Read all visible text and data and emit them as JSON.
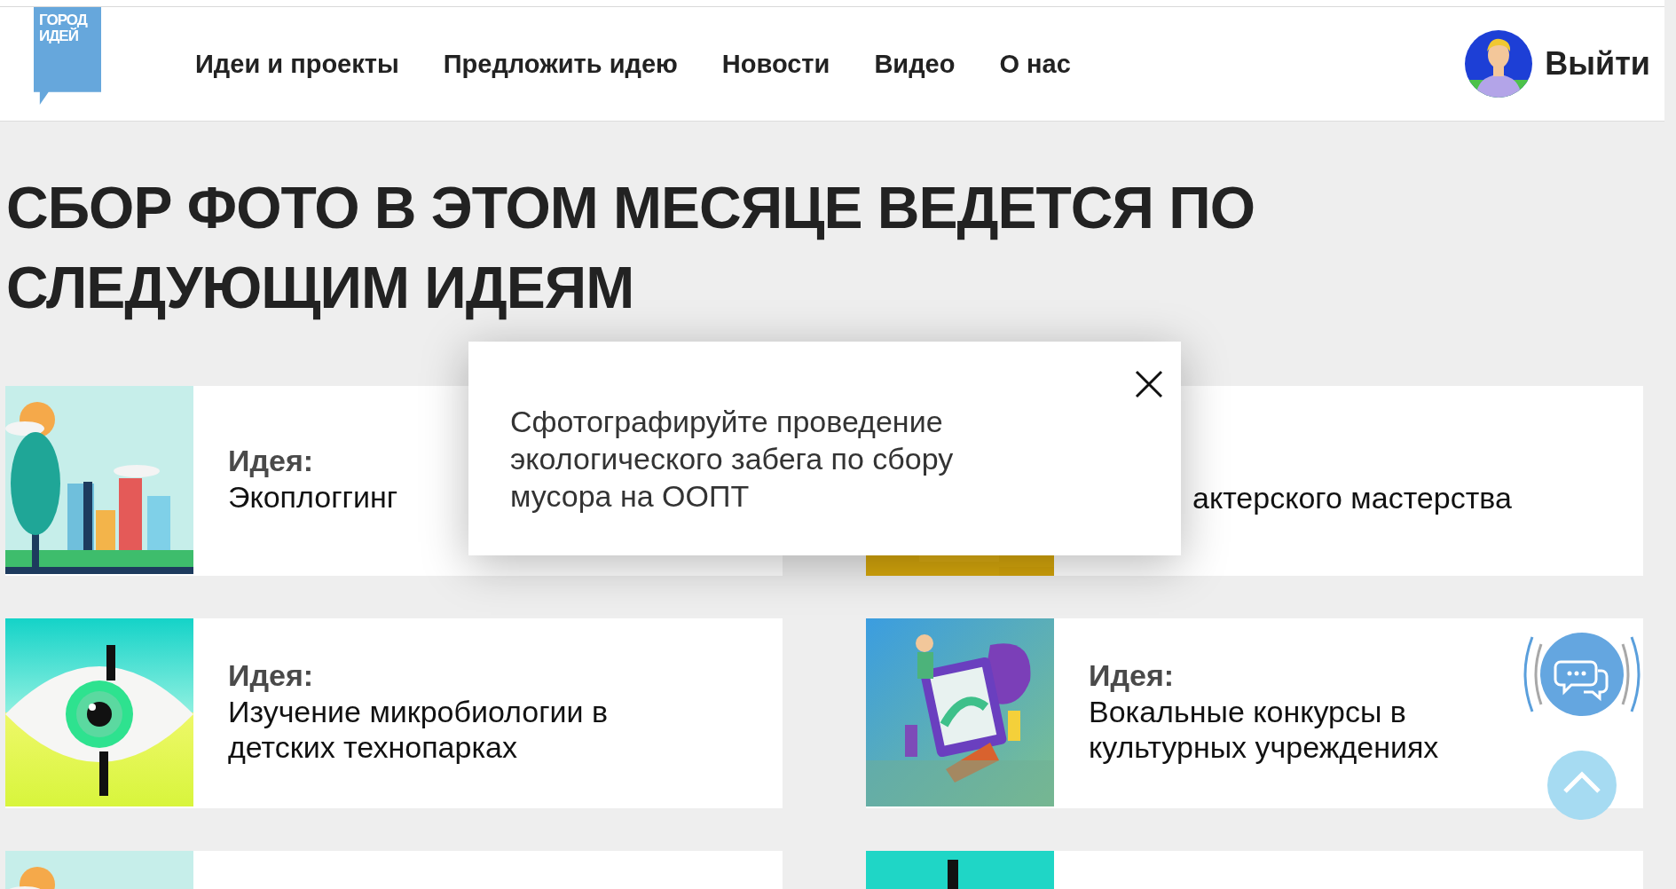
{
  "header": {
    "logo_text": "ГОРОД ИДЕЙ",
    "nav": [
      {
        "label": "Идеи и проекты"
      },
      {
        "label": "Предложить идею"
      },
      {
        "label": "Новости"
      },
      {
        "label": "Видео"
      },
      {
        "label": "О нас"
      }
    ],
    "logout": "Выйти"
  },
  "heading": "СБОР ФОТО В ЭТОМ МЕСЯЦЕ ВЕДЕТСЯ ПО СЛЕДУЮЩИМ ИДЕЯМ",
  "cards": [
    {
      "image": {
        "kind": "picture"
      },
      "label": "Идея:",
      "title": "Экоплоггинг"
    },
    {
      "image": {
        "kind": "picture"
      },
      "title": "актерского мастерства"
    },
    {
      "image": {
        "kind": "picture"
      },
      "label": "Идея:",
      "title": "Изучение микробиологии в детских технопарках"
    },
    {
      "image": {
        "kind": "picture"
      },
      "label": "Идея:",
      "title": "Вокальные конкурсы в культурных учреждениях"
    },
    {
      "image": {
        "kind": "picture"
      }
    },
    {
      "image": {
        "kind": "picture"
      }
    }
  ],
  "popup": {
    "text": "Сфотографируйте проведение экологического забега по сбору мусора на ООПТ"
  }
}
